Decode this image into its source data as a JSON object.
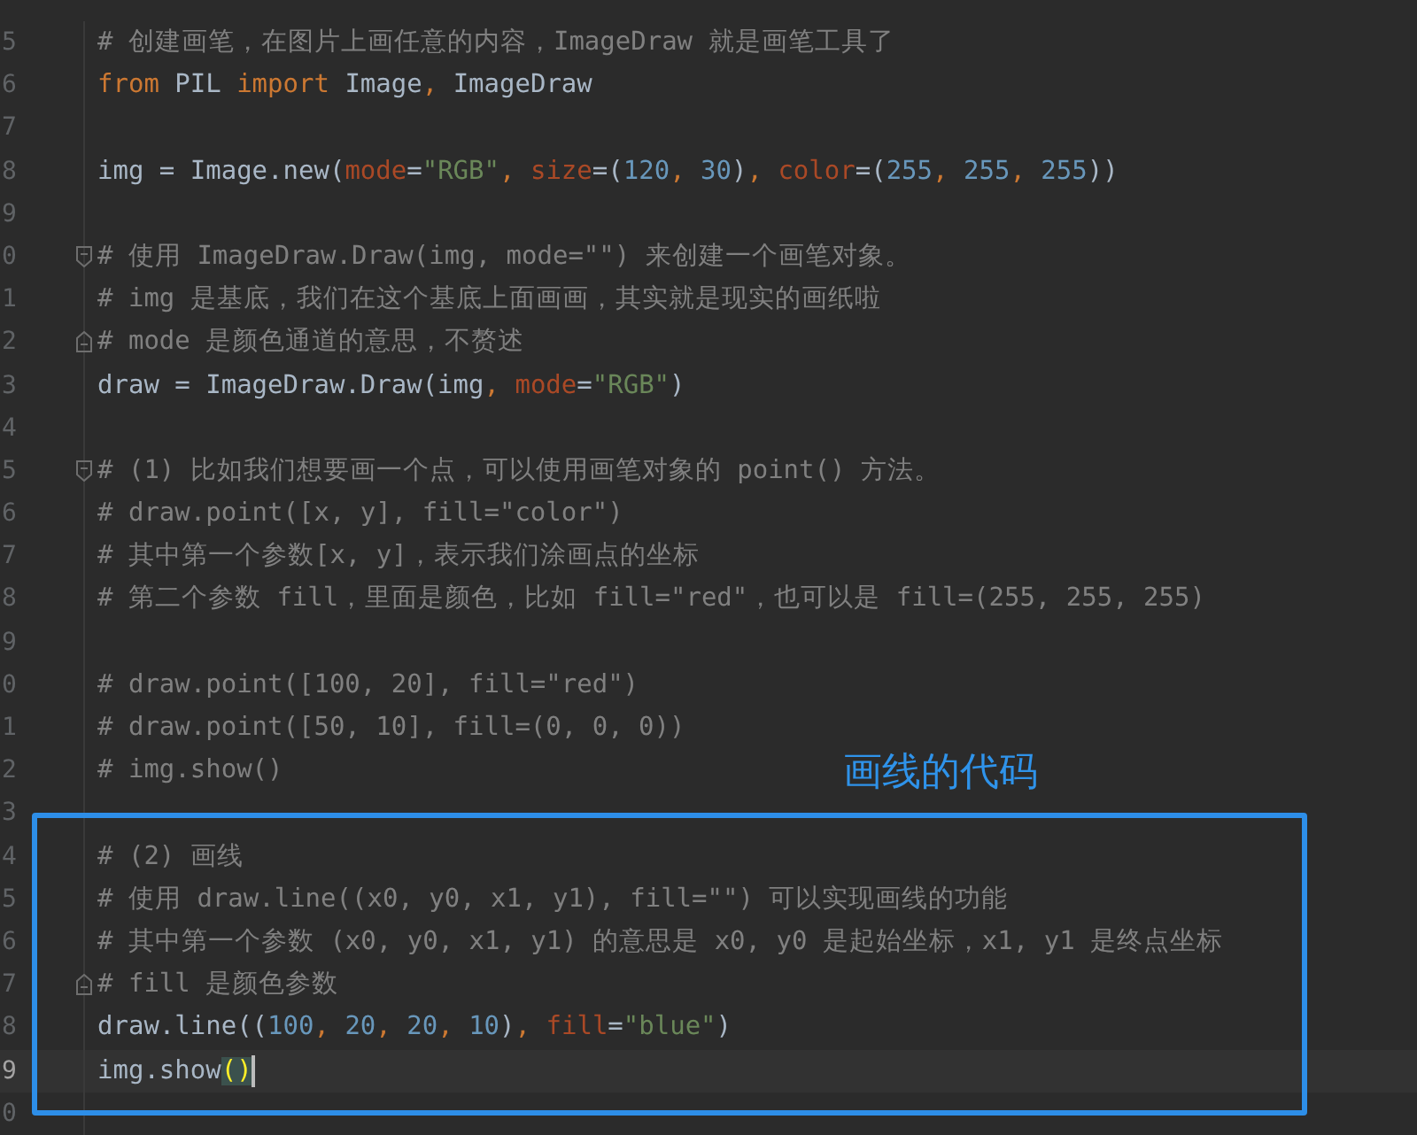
{
  "editor": {
    "lines": [
      {
        "kind": "code",
        "number": "5",
        "current": false,
        "tokens": [
          {
            "kind": "comment",
            "text": "# 创建画笔，在图片上画任意的内容，ImageDraw 就是画笔工具了"
          }
        ]
      },
      {
        "kind": "code",
        "number": "6",
        "current": false,
        "tokens": [
          {
            "kind": "keyword",
            "text": "from"
          },
          {
            "kind": "plain",
            "text": " PIL "
          },
          {
            "kind": "keyword",
            "text": "import"
          },
          {
            "kind": "plain",
            "text": " Image"
          },
          {
            "kind": "punct",
            "text": ","
          },
          {
            "kind": "plain",
            "text": " ImageDraw"
          }
        ]
      },
      {
        "kind": "code",
        "number": "7",
        "current": false
      },
      {
        "kind": "code",
        "number": "8",
        "current": false,
        "tokens": [
          {
            "kind": "plain",
            "text": "img = Image.new("
          },
          {
            "kind": "param",
            "text": "mode"
          },
          {
            "kind": "plain",
            "text": "="
          },
          {
            "kind": "string",
            "text": "\"RGB\""
          },
          {
            "kind": "punct",
            "text": ", "
          },
          {
            "kind": "param",
            "text": "size"
          },
          {
            "kind": "plain",
            "text": "=("
          },
          {
            "kind": "number",
            "text": "120"
          },
          {
            "kind": "punct",
            "text": ", "
          },
          {
            "kind": "number",
            "text": "30"
          },
          {
            "kind": "plain",
            "text": ")"
          },
          {
            "kind": "punct",
            "text": ", "
          },
          {
            "kind": "param",
            "text": "color"
          },
          {
            "kind": "plain",
            "text": "=("
          },
          {
            "kind": "number",
            "text": "255"
          },
          {
            "kind": "punct",
            "text": ", "
          },
          {
            "kind": "number",
            "text": "255"
          },
          {
            "kind": "punct",
            "text": ", "
          },
          {
            "kind": "number",
            "text": "255"
          },
          {
            "kind": "plain",
            "text": "))"
          }
        ]
      },
      {
        "kind": "code",
        "number": "9",
        "current": false
      },
      {
        "kind": "fold-start",
        "number": "0",
        "current": false,
        "tokens": [
          {
            "kind": "comment",
            "text": "# 使用 ImageDraw.Draw(img, mode=\"\") 来创建一个画笔对象。"
          }
        ]
      },
      {
        "kind": "code",
        "number": "1",
        "current": false,
        "tokens": [
          {
            "kind": "comment",
            "text": "# img 是基底，我们在这个基底上面画画，其实就是现实的画纸啦"
          }
        ]
      },
      {
        "kind": "fold-end",
        "number": "2",
        "current": false,
        "tokens": [
          {
            "kind": "comment",
            "text": "# mode 是颜色通道的意思，不赘述"
          }
        ]
      },
      {
        "kind": "code",
        "number": "3",
        "current": false,
        "tokens": [
          {
            "kind": "plain",
            "text": "draw = ImageDraw.Draw(img"
          },
          {
            "kind": "punct",
            "text": ", "
          },
          {
            "kind": "param",
            "text": "mode"
          },
          {
            "kind": "plain",
            "text": "="
          },
          {
            "kind": "string",
            "text": "\"RGB\""
          },
          {
            "kind": "plain",
            "text": ")"
          }
        ]
      },
      {
        "kind": "code",
        "number": "4",
        "current": false
      },
      {
        "kind": "fold-start",
        "number": "5",
        "current": false,
        "tokens": [
          {
            "kind": "comment",
            "text": "# (1) 比如我们想要画一个点，可以使用画笔对象的 point() 方法。"
          }
        ]
      },
      {
        "kind": "code",
        "number": "6",
        "current": false,
        "tokens": [
          {
            "kind": "comment",
            "text": "# draw.point([x, y], fill=\"color\")"
          }
        ]
      },
      {
        "kind": "code",
        "number": "7",
        "current": false,
        "tokens": [
          {
            "kind": "comment",
            "text": "# 其中第一个参数[x, y]，表示我们涂画点的坐标"
          }
        ]
      },
      {
        "kind": "code",
        "number": "8",
        "current": false,
        "tokens": [
          {
            "kind": "comment",
            "text": "# 第二个参数 fill，里面是颜色，比如 fill=\"red\"，也可以是 fill=(255, 255, 255)"
          }
        ]
      },
      {
        "kind": "code",
        "number": "9",
        "current": false
      },
      {
        "kind": "code",
        "number": "0",
        "current": false,
        "tokens": [
          {
            "kind": "comment",
            "text": "# draw.point([100, 20], fill=\"red\")"
          }
        ]
      },
      {
        "kind": "code",
        "number": "1",
        "current": false,
        "tokens": [
          {
            "kind": "comment",
            "text": "# draw.point([50, 10], fill=(0, 0, 0))"
          }
        ]
      },
      {
        "kind": "code",
        "number": "2",
        "current": false,
        "tokens": [
          {
            "kind": "comment",
            "text": "# img.show()"
          }
        ]
      },
      {
        "kind": "code",
        "number": "3",
        "current": false
      },
      {
        "kind": "code",
        "number": "4",
        "current": false,
        "tokens": [
          {
            "kind": "comment",
            "text": "# (2) 画线"
          }
        ]
      },
      {
        "kind": "code",
        "number": "5",
        "current": false,
        "tokens": [
          {
            "kind": "comment",
            "text": "# 使用 draw.line((x0, y0, x1, y1), fill=\"\") 可以实现画线的功能"
          }
        ]
      },
      {
        "kind": "code",
        "number": "6",
        "current": false,
        "tokens": [
          {
            "kind": "comment",
            "text": "# 其中第一个参数 (x0, y0, x1, y1) 的意思是 x0, y0 是起始坐标，x1, y1 是终点坐标"
          }
        ]
      },
      {
        "kind": "fold-end",
        "number": "7",
        "current": false,
        "tokens": [
          {
            "kind": "comment",
            "text": "# fill 是颜色参数"
          }
        ]
      },
      {
        "kind": "code",
        "number": "8",
        "current": false,
        "tokens": [
          {
            "kind": "plain",
            "text": "draw.line(("
          },
          {
            "kind": "number",
            "text": "100"
          },
          {
            "kind": "punct",
            "text": ", "
          },
          {
            "kind": "number",
            "text": "20"
          },
          {
            "kind": "punct",
            "text": ", "
          },
          {
            "kind": "number",
            "text": "20"
          },
          {
            "kind": "punct",
            "text": ", "
          },
          {
            "kind": "number",
            "text": "10"
          },
          {
            "kind": "plain",
            "text": ")"
          },
          {
            "kind": "punct",
            "text": ", "
          },
          {
            "kind": "param",
            "text": "fill"
          },
          {
            "kind": "plain",
            "text": "="
          },
          {
            "kind": "string",
            "text": "\"blue\""
          },
          {
            "kind": "plain",
            "text": ")"
          }
        ]
      },
      {
        "kind": "code",
        "number": "9",
        "current": true,
        "tokens": [
          {
            "kind": "plain",
            "text": "img.show"
          },
          {
            "kind": "brace-match",
            "text": "()"
          }
        ]
      },
      {
        "kind": "code",
        "number": "0",
        "current": false
      }
    ]
  },
  "annotation": {
    "label": "画线的代码"
  }
}
